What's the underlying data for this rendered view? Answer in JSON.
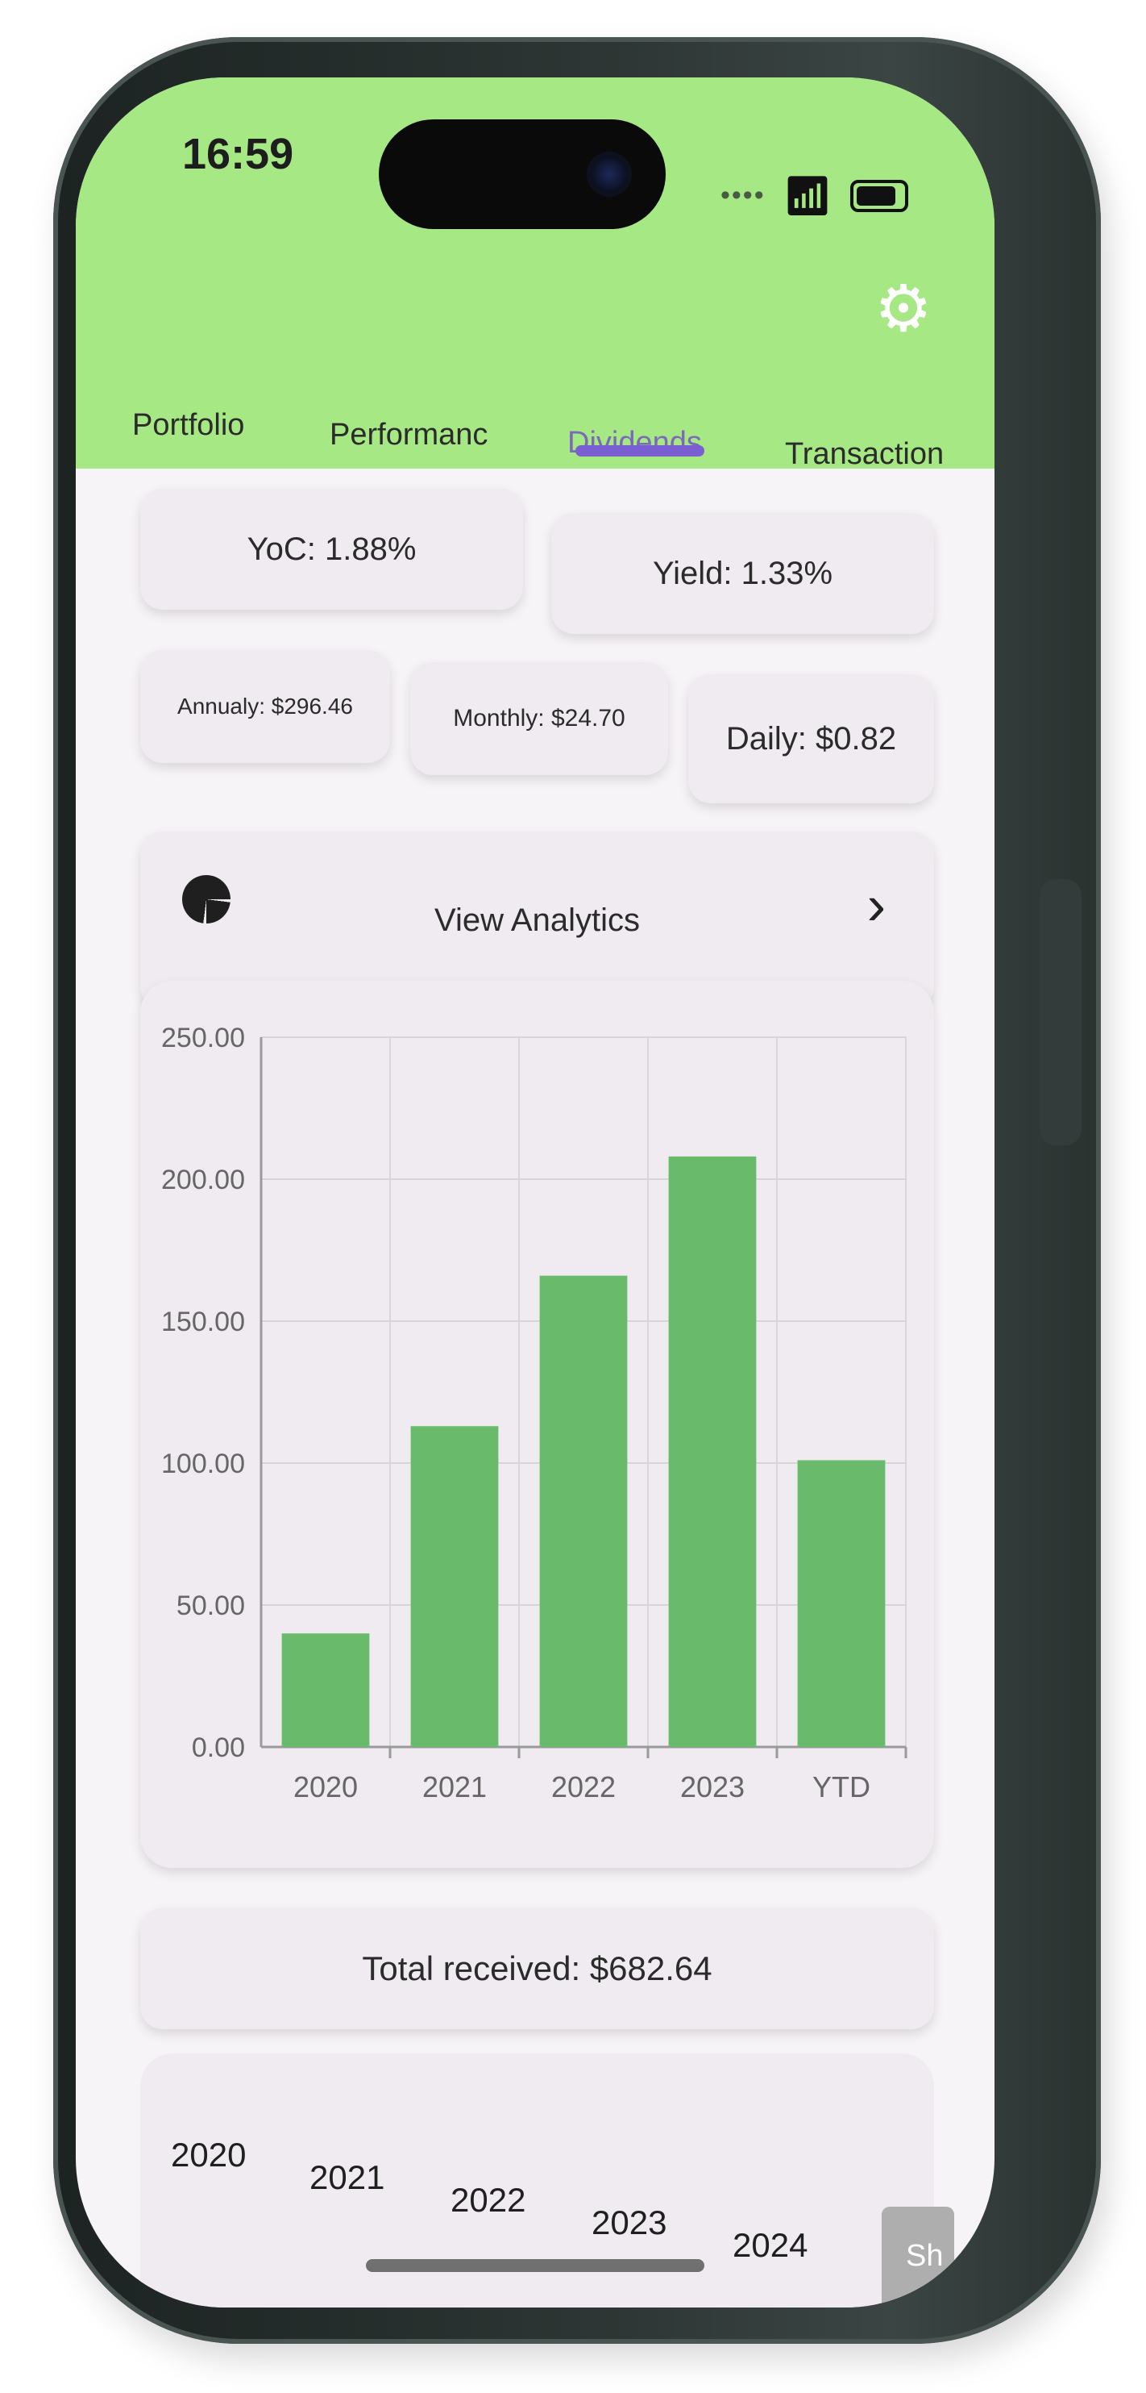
{
  "status_bar": {
    "time": "16:59"
  },
  "tabs": [
    {
      "label": "Portfolio",
      "active": false
    },
    {
      "label": "Performanc",
      "active": false
    },
    {
      "label": "Dividends",
      "active": true
    },
    {
      "label": "Transaction",
      "active": false
    }
  ],
  "stats": {
    "yoc": "YoC: 1.88%",
    "yield": "Yield: 1.33%",
    "annual": "Annualy: $296.46",
    "monthly": "Monthly: $24.70",
    "daily": "Daily: $0.82"
  },
  "analytics_button": {
    "label": "View Analytics"
  },
  "chart_data": {
    "type": "bar",
    "categories": [
      "2020",
      "2021",
      "2022",
      "2023",
      "YTD"
    ],
    "values": [
      40,
      113,
      166,
      208,
      101
    ],
    "ylim": [
      0,
      250
    ],
    "yticks": [
      "0.00",
      "50.00",
      "100.00",
      "150.00",
      "200.00",
      "250.00"
    ],
    "grid": true,
    "bar_color": "#69bb6b"
  },
  "total": {
    "label": "Total received: $682.64"
  },
  "year_selector": {
    "years": [
      "2020",
      "2021",
      "2022",
      "2023",
      "2024"
    ],
    "share_label": "Sh"
  },
  "colors": {
    "header": "#a6e884",
    "accent": "#7a5fd2",
    "card": "#efebf0"
  }
}
